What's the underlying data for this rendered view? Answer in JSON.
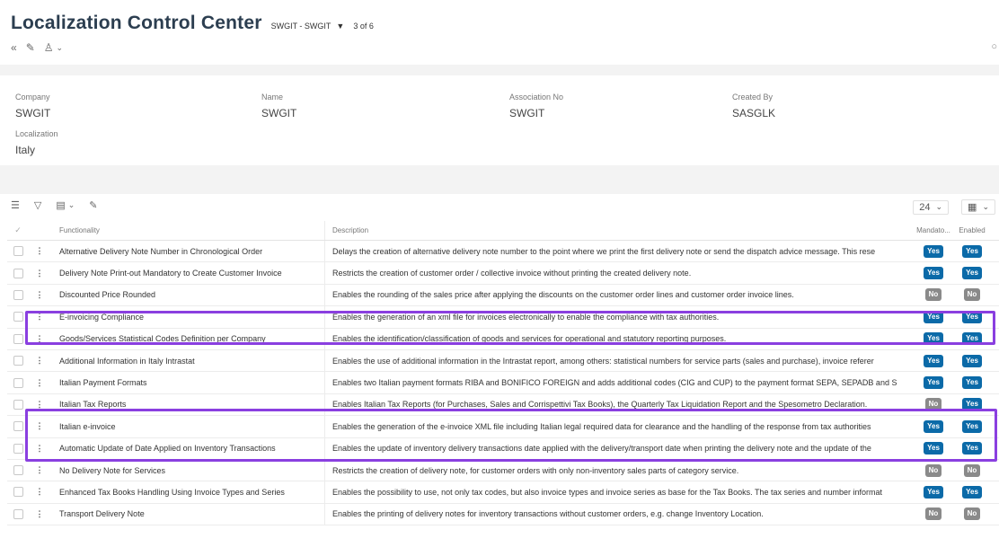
{
  "header": {
    "title": "Localization Control Center",
    "record_selector": "SWGIT - SWGIT",
    "record_counter": "3 of 6"
  },
  "detail": {
    "company": {
      "label": "Company",
      "value": "SWGIT"
    },
    "name": {
      "label": "Name",
      "value": "SWGIT"
    },
    "association_no": {
      "label": "Association No",
      "value": "SWGIT"
    },
    "created_by": {
      "label": "Created By",
      "value": "SASGLK"
    },
    "localization": {
      "label": "Localization",
      "value": "Italy"
    }
  },
  "grid_toolbar": {
    "page_size": "24"
  },
  "grid": {
    "columns": {
      "functionality": "Functionality",
      "description": "Description",
      "mandatory": "Mandato...",
      "enabled": "Enabled"
    },
    "rows": [
      {
        "functionality": "Alternative Delivery Note Number in Chronological Order",
        "description": "Delays the creation of alternative delivery note number to the point where we print the first delivery note or send the dispatch advice message. This rese",
        "mandatory": "Yes",
        "enabled": "Yes"
      },
      {
        "functionality": "Delivery Note Print-out Mandatory to Create Customer Invoice",
        "description": "Restricts the creation of customer order / collective invoice without printing the created delivery note.",
        "mandatory": "Yes",
        "enabled": "Yes"
      },
      {
        "functionality": "Discounted Price Rounded",
        "description": "Enables the rounding of the sales price after applying the discounts on the customer order lines and customer order invoice lines.",
        "mandatory": "No",
        "enabled": "No"
      },
      {
        "functionality": "E-invoicing Compliance",
        "description": "Enables the generation of an xml file for invoices electronically to enable the compliance with tax authorities.",
        "mandatory": "Yes",
        "enabled": "Yes"
      },
      {
        "functionality": "Goods/Services Statistical Codes Definition per Company",
        "description": "Enables the identification/classification of goods and services for operational and statutory reporting purposes.",
        "mandatory": "Yes",
        "enabled": "Yes"
      },
      {
        "functionality": "Additional Information in Italy Intrastat",
        "description": "Enables the use of additional information in the Intrastat report, among others: statistical numbers for service parts (sales and purchase), invoice referer",
        "mandatory": "Yes",
        "enabled": "Yes"
      },
      {
        "functionality": "Italian Payment Formats",
        "description": "Enables two Italian payment formats RIBA and BONIFICO FOREIGN and adds additional codes (CIG and CUP) to the payment format SEPA, SEPADB and S",
        "mandatory": "Yes",
        "enabled": "Yes"
      },
      {
        "functionality": "Italian Tax Reports",
        "description": "Enables Italian Tax Reports (for Purchases, Sales and Corrispettivi Tax Books), the Quarterly Tax Liquidation Report and the Spesometro Declaration.",
        "mandatory": "No",
        "enabled": "Yes"
      },
      {
        "functionality": "Italian e-invoice",
        "description": "Enables the generation of the e-invoice XML file including Italian legal required data for clearance and the handling of the response from tax authorities",
        "mandatory": "Yes",
        "enabled": "Yes"
      },
      {
        "functionality": "Automatic Update of Date Applied on Inventory Transactions",
        "description": "Enables the update of inventory delivery transactions date applied with the delivery/transport date when printing the delivery note and the update of the",
        "mandatory": "Yes",
        "enabled": "Yes"
      },
      {
        "functionality": "No Delivery Note for Services",
        "description": "Restricts the creation of delivery note, for customer orders with only non-inventory sales parts of category service.",
        "mandatory": "No",
        "enabled": "No"
      },
      {
        "functionality": "Enhanced Tax Books Handling Using Invoice Types and Series",
        "description": "Enables the possibility to use, not only tax codes, but also invoice types and invoice series as base for the Tax Books. The tax series and number informat",
        "mandatory": "Yes",
        "enabled": "Yes"
      },
      {
        "functionality": "Transport Delivery Note",
        "description": "Enables the printing of delivery notes for inventory transactions without customer orders, e.g. change Inventory Location.",
        "mandatory": "No",
        "enabled": "No"
      }
    ]
  },
  "colors": {
    "yes_badge": "#0b6aa8",
    "no_badge": "#8a8a8a",
    "highlight": "#8a3fe0"
  }
}
